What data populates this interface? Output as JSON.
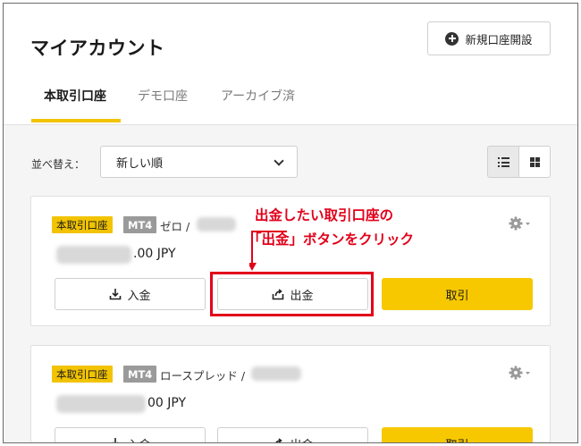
{
  "header": {
    "title": "マイアカウント",
    "new_account_label": "新規口座開設"
  },
  "tabs": [
    {
      "label": "本取引口座",
      "active": true
    },
    {
      "label": "デモ口座",
      "active": false
    },
    {
      "label": "アーカイブ済",
      "active": false
    }
  ],
  "sort": {
    "label": "並べ替え：",
    "selected": "新しい順"
  },
  "accounts": [
    {
      "badge": "本取引口座",
      "platform": "MT4",
      "name": "ゼロ /",
      "balance_suffix": ".00 JPY",
      "deposit_label": "入金",
      "withdraw_label": "出金",
      "trade_label": "取引"
    },
    {
      "badge": "本取引口座",
      "platform": "MT4",
      "name": "ロースプレッド /",
      "balance_suffix": "00 JPY",
      "deposit_label": "入金",
      "withdraw_label": "出金",
      "trade_label": "取引"
    }
  ],
  "annotation": {
    "line1": "出金したい取引口座の",
    "line2": "「出金」ボタンをクリック"
  },
  "colors": {
    "accent": "#f2c300",
    "annotation": "#e2001a"
  }
}
